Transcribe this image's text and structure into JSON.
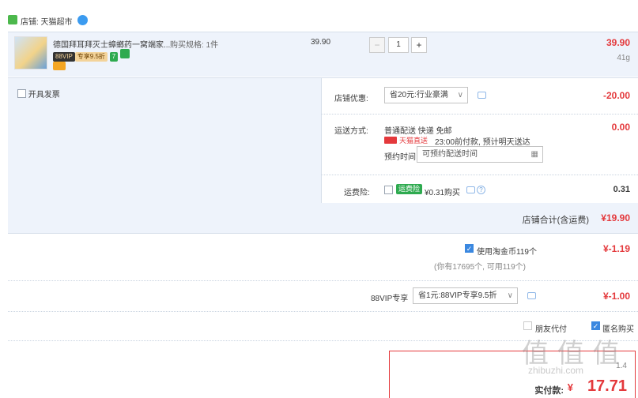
{
  "shop": {
    "label": "店铺: 天猫超市"
  },
  "item": {
    "title": "德国拜耳拜灭士蟑螂药一窝端家...",
    "spec": "购买规格: 1件",
    "vip_badge": "88VIP",
    "vip_discount": "专享9.5折",
    "badge_7": "7",
    "unit_price": "39.90",
    "quantity": "1",
    "total": "39.90",
    "weight": "41g"
  },
  "invoice": {
    "label": "开具发票"
  },
  "store_discount": {
    "label": "店铺优惠:",
    "selected": "省20元:行业豪满",
    "amount": "-20.00"
  },
  "shipping": {
    "label": "运送方式:",
    "method": "普通配送 快递 免邮",
    "tmall_label": "天猫直送",
    "eta": "23:00前付款, 预计明天送达",
    "appointment_label": "预约时间",
    "appointment_placeholder": "可预约配送时间",
    "amount": "0.00"
  },
  "insurance": {
    "label": "运费险:",
    "tag": "运费险",
    "price": "¥0.31购买",
    "amount": "0.31"
  },
  "store_total": {
    "label": "店铺合计(含运费)",
    "amount": "¥19.90"
  },
  "coins": {
    "label": "使用淘金币119个",
    "note": "(你有17695个, 可用119个)",
    "amount": "¥-1.19"
  },
  "vip88": {
    "label": "88VIP专享",
    "selected": "省1元:88VIP专享9.5折",
    "amount": "¥-1.00"
  },
  "bottom_options": {
    "friend_pay": "朋友代付",
    "anonymous": "匿名购买"
  },
  "summary": {
    "label": "实付款:",
    "currency": "¥",
    "amount": "17.71",
    "small_note": "1.4"
  },
  "watermark": "值 值 值",
  "watermark_url": "zhibuzhi.com",
  "colors": {
    "accent_red": "#e4393c",
    "row_blue": "#eef3fb",
    "check_blue": "#3b88e0"
  }
}
